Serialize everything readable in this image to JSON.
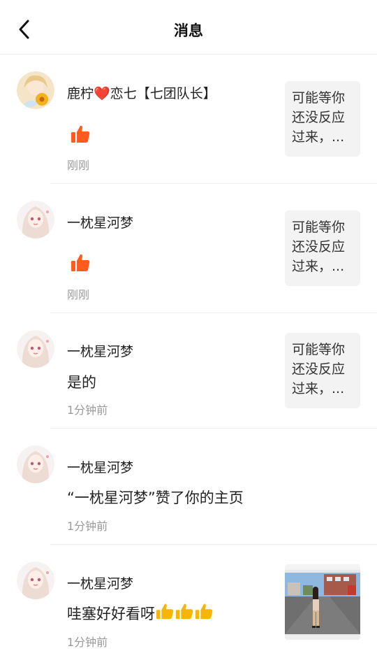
{
  "header": {
    "title": "消息"
  },
  "messages": [
    {
      "name_before": "鹿柠",
      "name_after": "恋七【七团队长】",
      "content": "",
      "time": "刚刚",
      "preview": "可能等你还没反应过来，..."
    },
    {
      "name": "一枕星河梦",
      "content": "",
      "time": "刚刚",
      "preview": "可能等你还没反应过来，..."
    },
    {
      "name": "一枕星河梦",
      "content": "是的",
      "time": "1分钟前",
      "preview": "可能等你还没反应过来，..."
    },
    {
      "name": "一枕星河梦",
      "content": "“一枕星河梦”赞了你的主页",
      "time": "1分钟前"
    },
    {
      "name": "一枕星河梦",
      "content": "哇塞好好看呀",
      "time": "1分钟前"
    }
  ],
  "colors": {
    "accent": "#ff5a1f",
    "heart": "#d41f1f"
  }
}
